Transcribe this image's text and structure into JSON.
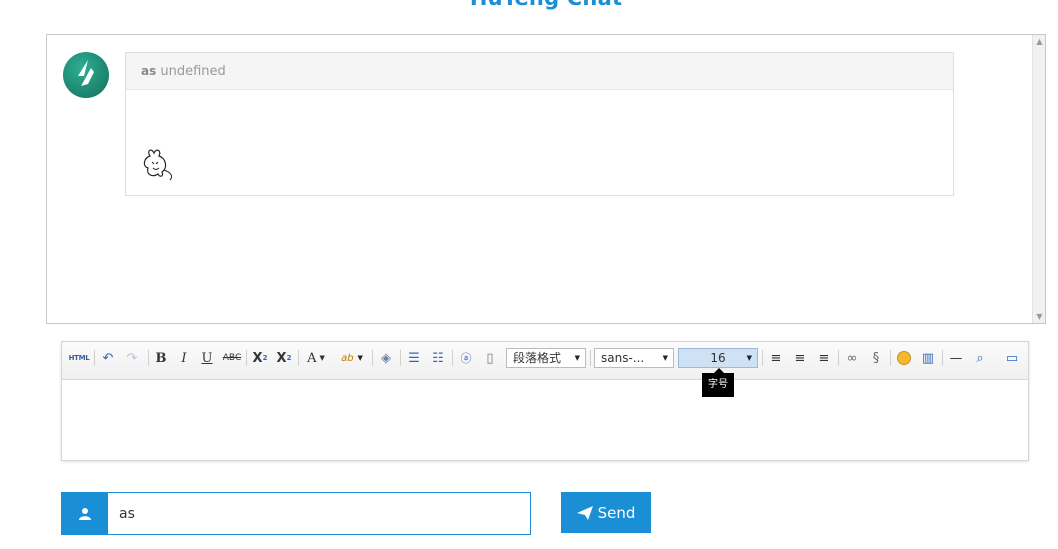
{
  "app": {
    "title": "HuTeng Chat"
  },
  "message": {
    "user": "as",
    "text": "undefined"
  },
  "toolbar": {
    "html_label": "HTML",
    "paragraph_format": "段落格式",
    "font_family": "sans-...",
    "font_size": "16",
    "tooltip": "字号"
  },
  "form": {
    "name_value": "as",
    "send_label": "Send"
  },
  "colors": {
    "accent": "#1a8fd6"
  },
  "icons": [
    "user-icon",
    "paper-plane-icon",
    "undo-icon",
    "redo-icon",
    "bold-icon",
    "italic-icon",
    "underline-icon",
    "strikethrough-icon",
    "superscript-icon",
    "subscript-icon",
    "font-color-icon",
    "highlight-icon",
    "eraser-icon",
    "ordered-list-icon",
    "unordered-list-icon",
    "anchor-icon",
    "page-icon",
    "align-left-icon",
    "align-center-icon",
    "align-right-icon",
    "link-icon",
    "unlink-icon",
    "emoji-icon",
    "video-icon",
    "horizontal-rule-icon",
    "preview-icon",
    "fullscreen-icon"
  ]
}
